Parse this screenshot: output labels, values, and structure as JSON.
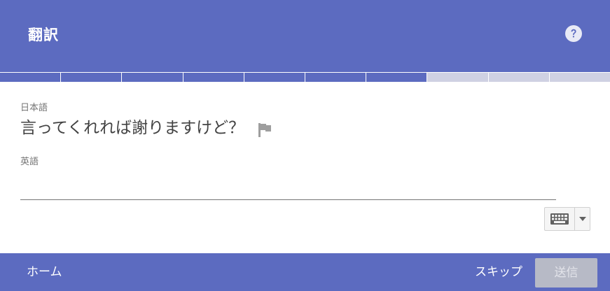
{
  "header": {
    "title": "翻訳",
    "help_icon": "help-circle-icon"
  },
  "progress": {
    "completed_segments": 7,
    "total_segments": 10,
    "colors": {
      "done": "#5c6bc0",
      "todo": "#cfd1e3"
    }
  },
  "source": {
    "language_label": "日本語",
    "sentence": "言ってくれれば謝りますけど？",
    "flag_icon": "flag-icon"
  },
  "target": {
    "language_label": "英語",
    "answer_value": "",
    "keyboard_icon": "keyboard-icon",
    "dropdown_icon": "caret-down-icon"
  },
  "footer": {
    "home_label": "ホーム",
    "skip_label": "スキップ",
    "submit_label": "送信",
    "submit_enabled": false
  },
  "colors": {
    "accent": "#5c6bc0",
    "text_primary": "#424242",
    "text_secondary": "#757575",
    "submit_disabled_bg": "#b7bac6"
  }
}
